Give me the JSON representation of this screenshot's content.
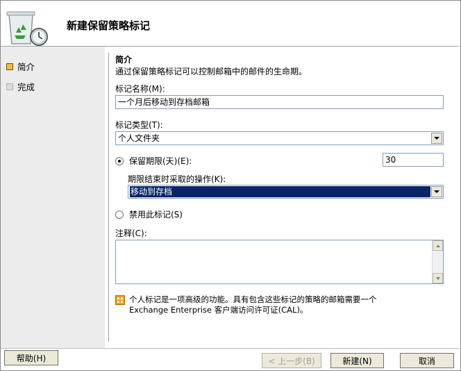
{
  "dialog": {
    "title": "新建保留策略标记"
  },
  "nav": {
    "items": [
      {
        "label": "简介",
        "state": "active"
      },
      {
        "label": "完成",
        "state": "inactive"
      }
    ]
  },
  "intro": {
    "heading": "简介",
    "description": "通过保留策略标记可以控制邮箱中的邮件的生命期。"
  },
  "form": {
    "name_label": "标记名称(M):",
    "name_value": "一个月后移动到存档邮箱",
    "type_label": "标记类型(T):",
    "type_value": "个人文件夹",
    "retention_radio_label": "保留期限(天)(E):",
    "retention_value": "30",
    "action_label": "期限结束时采取的操作(K):",
    "action_value": "移动到存档",
    "disable_radio_label": "禁用此标记(S)",
    "comment_label": "注释(C):",
    "comment_value": ""
  },
  "info": {
    "line1": "个人标记是一项高级的功能。具有包含这些标记的策略的邮箱需要一个",
    "line2": "Exchange Enterprise 客户端访问许可证(CAL)。"
  },
  "footer": {
    "help_label": "帮助(H)",
    "back_label": "< 上一步(B)",
    "new_label": "新建(N)",
    "cancel_label": "取消"
  },
  "colors": {
    "selection": "#0a246a",
    "nav_bg": "#ececec",
    "active_bullet": "#e8c040"
  }
}
